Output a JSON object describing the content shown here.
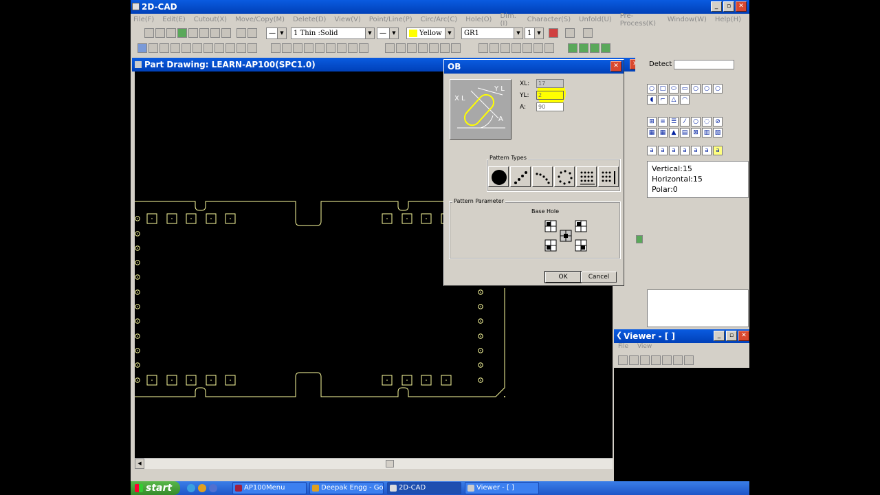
{
  "app": {
    "title": "2D-CAD",
    "menu": [
      "File(F)",
      "Edit(E)",
      "Cutout(X)",
      "Move/Copy(M)",
      "Delete(D)",
      "View(V)",
      "Point/Line(P)",
      "Circ/Arc(C)",
      "Hole(O)",
      "Dim.(I)",
      "Character(S)",
      "Unfold(U)",
      "Pre-Process(K)",
      "Window(W)",
      "Help(H)"
    ],
    "toolbar": {
      "line_type": "1 Thin :Solid",
      "color": "Yellow",
      "group": "GR1",
      "layer": "1"
    }
  },
  "part_window": {
    "title": "Part Drawing: LEARN-AP100(SPC1.0)"
  },
  "right_panel": {
    "detect_label": "Detect",
    "grid_info": [
      "Vertical:15",
      "Horizontal:15",
      "Polar:0"
    ]
  },
  "dialog": {
    "title": "OB",
    "params": [
      {
        "label": "XL:",
        "value": "17"
      },
      {
        "label": "YL:",
        "value": "2"
      },
      {
        "label": "A:",
        "value": "90"
      }
    ],
    "preview_labels": {
      "xl": "X L",
      "yl": "Y L",
      "a": "A"
    },
    "pattern_types_label": "Pattern Types",
    "pattern_parameter_label": "Pattern Parameter",
    "base_hole_label": "Base Hole",
    "ok": "OK",
    "cancel": "Cancel"
  },
  "viewer": {
    "title": "Viewer - [ ]",
    "menu": [
      "File",
      "View"
    ]
  },
  "taskbar": {
    "start": "start",
    "tasks": [
      {
        "label": "AP100Menu",
        "active": false
      },
      {
        "label": "Deepak Engg - Go...",
        "active": false
      },
      {
        "label": "2D-CAD",
        "active": true
      },
      {
        "label": "Viewer - [ ]",
        "active": false
      }
    ]
  },
  "colors": {
    "title_blue": "#0a5be0",
    "drawing_yellow": "#ffffa0",
    "highlight": "#ffff00",
    "close_red": "#d9482e"
  }
}
